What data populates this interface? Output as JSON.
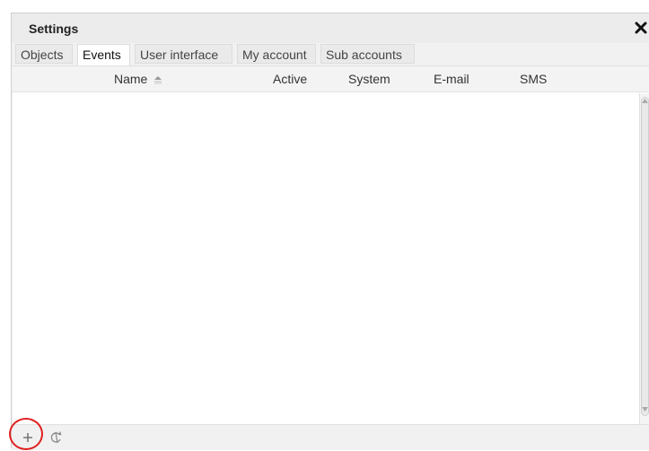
{
  "dialog": {
    "title": "Settings",
    "close_icon": "close-x-icon"
  },
  "tabs": [
    {
      "label": "Objects",
      "active": false
    },
    {
      "label": "Events",
      "active": true
    },
    {
      "label": "User interface",
      "active": false
    },
    {
      "label": "My account",
      "active": false
    },
    {
      "label": "Sub accounts",
      "active": false
    }
  ],
  "grid": {
    "columns": [
      {
        "label": "Name",
        "sort": "ascending"
      },
      {
        "label": "Active"
      },
      {
        "label": "System"
      },
      {
        "label": "E-mail"
      },
      {
        "label": "SMS"
      }
    ],
    "rows": []
  },
  "footer": {
    "add_icon": "plus-icon",
    "reload_icon": "refresh-icon"
  },
  "colors": {
    "highlight": "#e02020"
  }
}
